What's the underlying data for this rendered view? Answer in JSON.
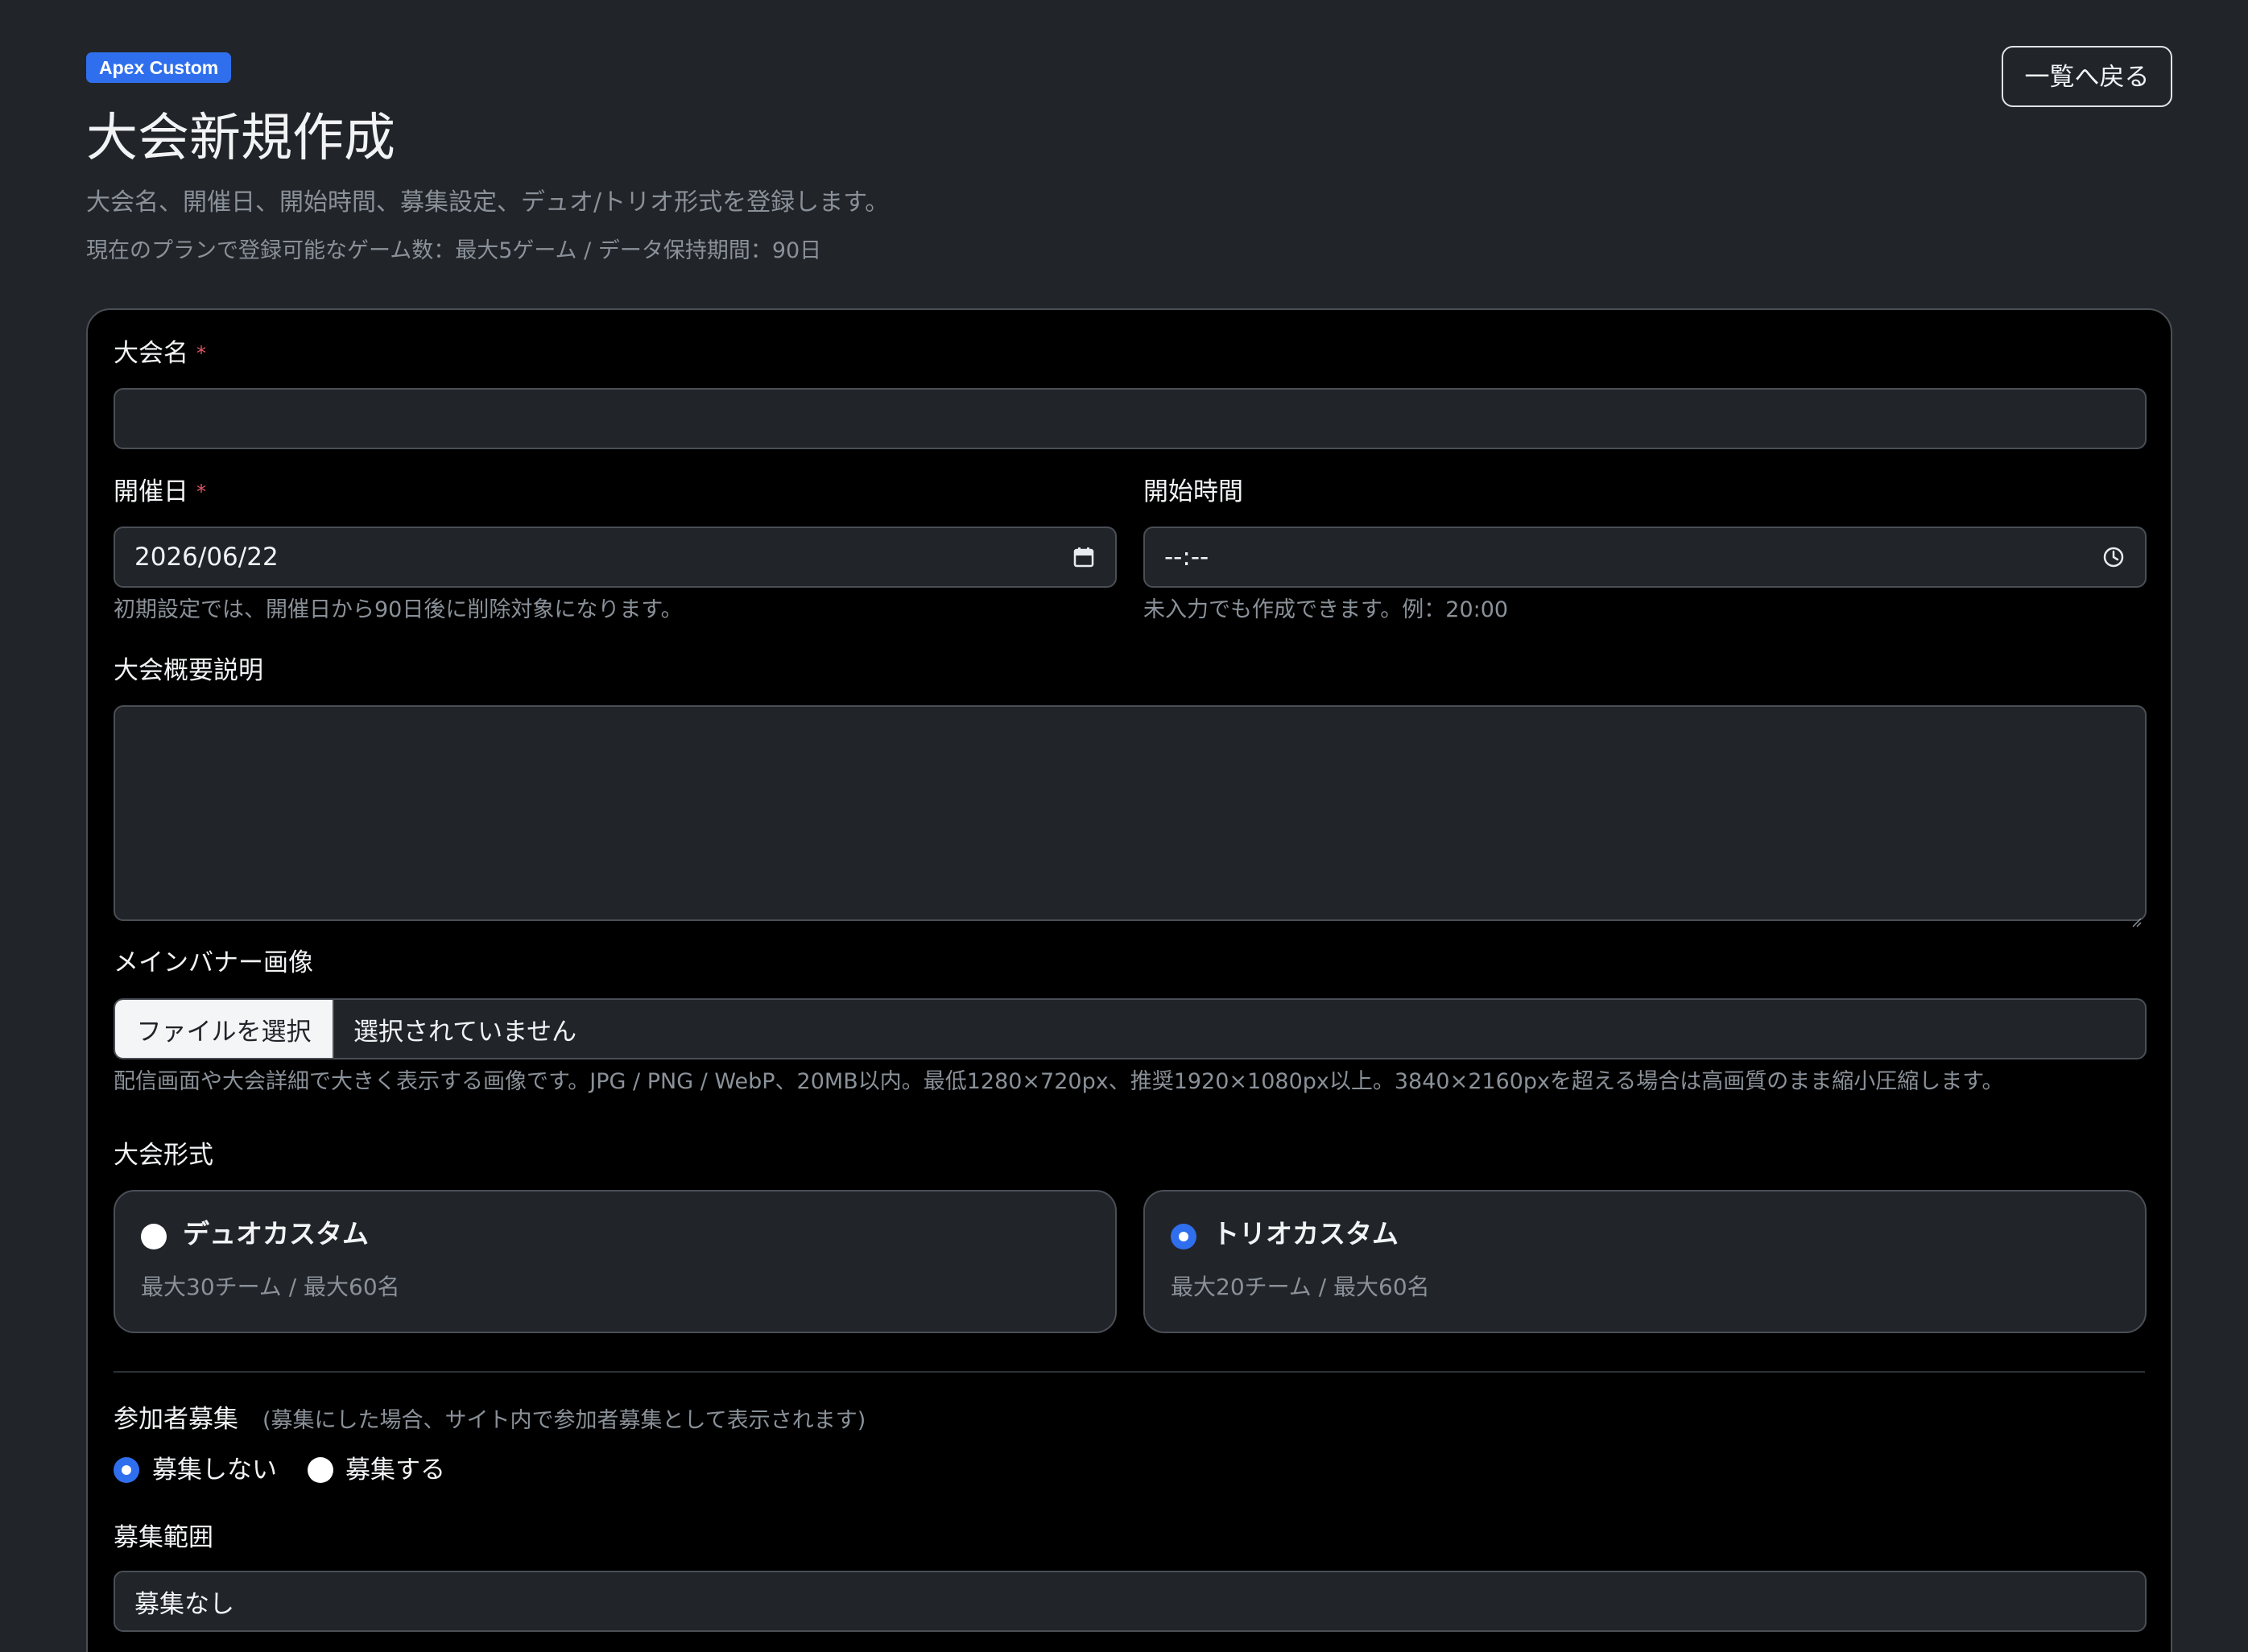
{
  "header": {
    "badge": "Apex Custom",
    "title": "大会新規作成",
    "subtitle": "大会名、開催日、開始時間、募集設定、デュオ/トリオ形式を登録します。",
    "plan_note": "現在のプランで登録可能なゲーム数：最大5ゲーム / データ保持期間：90日",
    "back_label": "一覧へ戻る"
  },
  "form": {
    "name": {
      "label": "大会名",
      "required_mark": "*",
      "value": ""
    },
    "date": {
      "label": "開催日",
      "required_mark": "*",
      "value": "2026/06/22",
      "help": "初期設定では、開催日から90日後に削除対象になります。"
    },
    "start_time": {
      "label": "開始時間",
      "value": "--:--",
      "help": "未入力でも作成できます。例：20:00"
    },
    "description": {
      "label": "大会概要説明",
      "value": ""
    },
    "banner": {
      "label": "メインバナー画像",
      "choose_label": "ファイルを選択",
      "status": "選択されていません",
      "help": "配信画面や大会詳細で大きく表示する画像です。JPG / PNG / WebP、20MB以内。最低1280×720px、推奨1920×1080px以上。3840×2160pxを超える場合は高画質のまま縮小圧縮します。"
    },
    "format": {
      "label": "大会形式",
      "options": [
        {
          "title": "デュオカスタム",
          "desc": "最大30チーム / 最大60名",
          "selected": false
        },
        {
          "title": "トリオカスタム",
          "desc": "最大20チーム / 最大60名",
          "selected": true
        }
      ]
    },
    "recruitment": {
      "label": "参加者募集",
      "note": "(募集にした場合、サイト内で参加者募集として表示されます)",
      "options": [
        {
          "label": "募集しない",
          "selected": true
        },
        {
          "label": "募集する",
          "selected": false
        }
      ]
    },
    "scope": {
      "label": "募集範囲",
      "value": "募集なし"
    }
  },
  "colors": {
    "background": "#212429",
    "card": "#000000",
    "accent": "#2f6fed",
    "required": "#e25563",
    "muted": "#8a9199"
  },
  "icons": {
    "date": "calendar-icon",
    "time": "clock-icon",
    "radio": "radio-icon"
  }
}
